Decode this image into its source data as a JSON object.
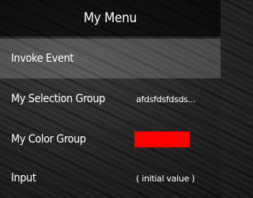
{
  "menu": {
    "title": "My Menu",
    "items": [
      {
        "label": "Invoke Event",
        "selected": true
      },
      {
        "label": "My Selection Group",
        "value": "afdsfdsfdsds..."
      },
      {
        "label": "My Color Group",
        "color": "#ff0000"
      },
      {
        "label": "Input",
        "value": "( initial value )"
      }
    ]
  },
  "colors": {
    "selection_highlight": "#ffffff2e",
    "text": "#ffffff",
    "header_background": "#000000"
  }
}
